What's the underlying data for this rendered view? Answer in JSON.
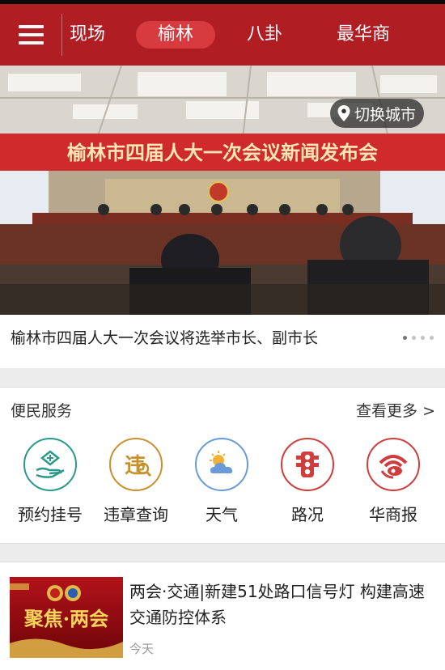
{
  "header": {
    "tabs": [
      {
        "label": "现场",
        "active": false
      },
      {
        "label": "榆林",
        "active": true
      },
      {
        "label": "八卦",
        "active": false
      },
      {
        "label": "最华商",
        "active": false
      }
    ]
  },
  "banner": {
    "city_switch_label": "切换城市",
    "photo_banner_text": "榆林市四届人大一次会议新闻发布会",
    "caption": "榆林市四届人大一次会议将选举市长、副市长",
    "slide_count": 4,
    "active_slide": 1
  },
  "services": {
    "title": "便民服务",
    "more_label": "查看更多 >",
    "items": [
      {
        "label": "预约挂号",
        "icon": "hand-medical-icon",
        "color": "#2a9a8a"
      },
      {
        "label": "违章查询",
        "icon": "traffic-violation-icon",
        "color": "#c8912f"
      },
      {
        "label": "天气",
        "icon": "weather-icon",
        "color": "#6a9bd6"
      },
      {
        "label": "路况",
        "icon": "traffic-light-icon",
        "color": "#d03d3d"
      },
      {
        "label": "华商报",
        "icon": "huashang-logo-icon",
        "color": "#d03d3d"
      }
    ]
  },
  "news": {
    "items": [
      {
        "title": "两会·交通|新建51处路口信号灯 构建高速交通防控体系",
        "time": "今天",
        "thumb_text": "聚焦·两会"
      }
    ]
  },
  "colors": {
    "brand_red": "#b01e23",
    "active_tab": "#d73a3f"
  }
}
